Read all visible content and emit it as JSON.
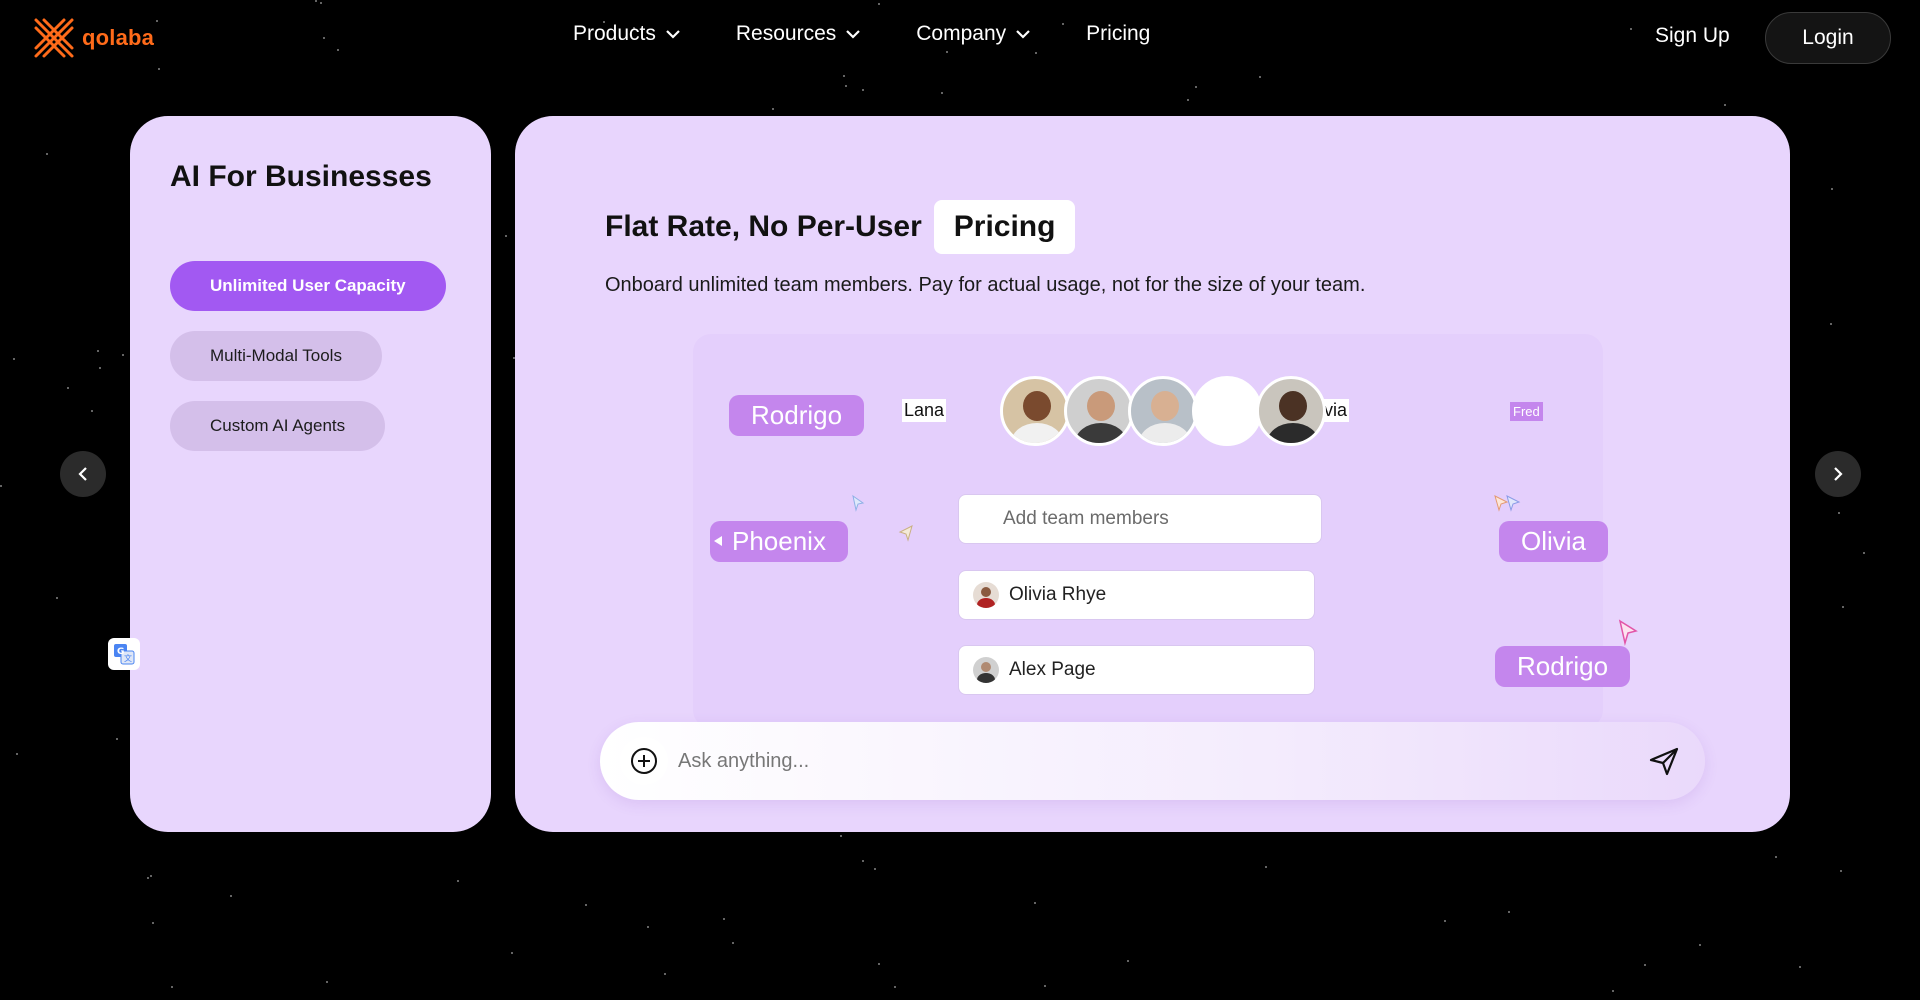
{
  "brand": {
    "name": "qolaba",
    "color": "#ff6b1a"
  },
  "nav": {
    "items": [
      {
        "label": "Products",
        "has_dropdown": true
      },
      {
        "label": "Resources",
        "has_dropdown": true
      },
      {
        "label": "Company",
        "has_dropdown": true
      },
      {
        "label": "Pricing",
        "has_dropdown": false
      }
    ],
    "signup_label": "Sign Up",
    "login_label": "Login"
  },
  "left_card": {
    "title": "AI For Businesses",
    "options": [
      {
        "label": "Unlimited User Capacity",
        "active": true
      },
      {
        "label": "Multi-Modal Tools",
        "active": false
      },
      {
        "label": "Custom AI Agents",
        "active": false
      }
    ]
  },
  "main_card": {
    "headline": "Flat Rate, No Per-User",
    "headline_chip": "Pricing",
    "subline": "Onboard unlimited team members. Pay for actual usage, not for the size of your team.",
    "illustration": {
      "tags": [
        "Rodrigo",
        "Phoenix",
        "Olivia",
        "Rodrigo"
      ],
      "labels": [
        "Lana",
        "Olivia",
        "Fred"
      ],
      "add_members_placeholder": "Add team members",
      "members": [
        "Olivia Rhye",
        "Alex Page"
      ]
    },
    "ask": {
      "placeholder": "Ask anything..."
    }
  },
  "colors": {
    "accent": "#a259f2",
    "card_bg": "#e8d6fd",
    "tag_bg": "#c486ed"
  },
  "icons": [
    "chevron-down-icon",
    "chevron-left-icon",
    "chevron-right-icon",
    "plus-circle-icon",
    "send-icon",
    "translate-icon"
  ]
}
